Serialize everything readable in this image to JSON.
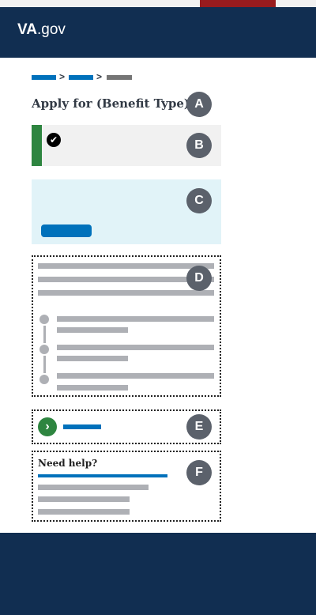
{
  "header": {
    "logo_main": "VA",
    "logo_suffix": ".gov"
  },
  "breadcrumb": {
    "separators": [
      ">",
      ">"
    ]
  },
  "page": {
    "title": "Apply for (Benefit Type)"
  },
  "markers": [
    "A",
    "B",
    "C",
    "D",
    "E",
    "F"
  ],
  "icons": {
    "success": "check-circle-icon",
    "go": "chevron-right-circle-icon"
  },
  "help": {
    "title": "Need help?"
  },
  "colors": {
    "header_bg": "#112e51",
    "red_tab": "#981b1e",
    "link_blue": "#0071bb",
    "success_green": "#2e8540",
    "info_bg": "#e1f3f8",
    "alert_bg": "#f1f1f1",
    "placeholder_gray": "#aeb0b5",
    "marker_gray": "#5b616b"
  }
}
